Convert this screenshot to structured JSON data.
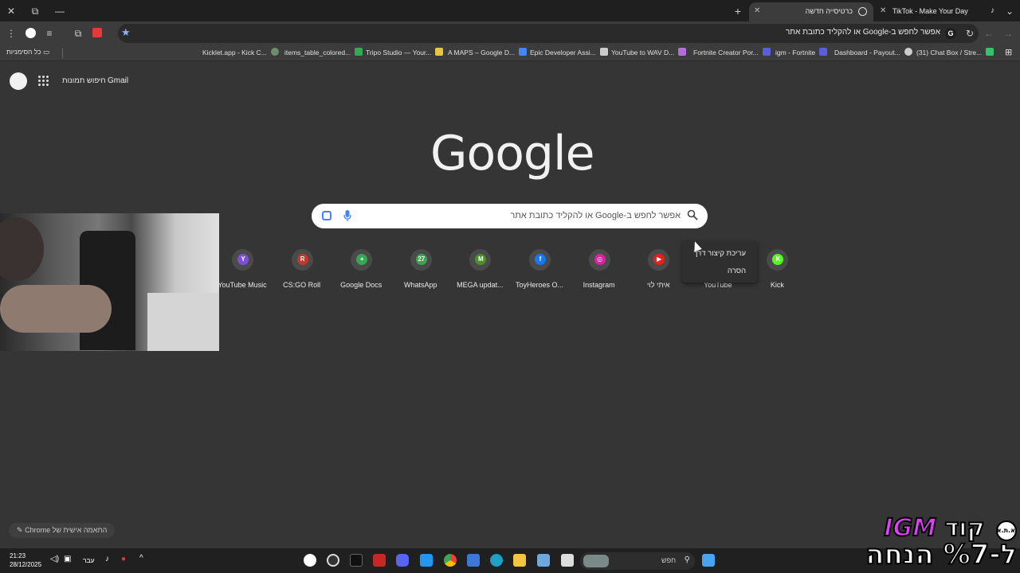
{
  "tabs": [
    {
      "title": "TikTok - Make Your Day",
      "active": false
    },
    {
      "title": "כרטיסייה חדשה",
      "active": true
    }
  ],
  "omnibox": {
    "text": "אפשר לחפש ב-Google או להקליד כתובת אתר",
    "badge": "G"
  },
  "bookmarks": {
    "all_label": "כל הסימניות",
    "items": [
      {
        "label": "Kicklet.app - Kick C...",
        "color": "#6b8f6b"
      },
      {
        "label": "items_table_colored...",
        "color": "#34a853"
      },
      {
        "label": "Tripo Studio — Your...",
        "color": "#e8c44a"
      },
      {
        "label": "A MAPS – Google D...",
        "color": "#4285f4"
      },
      {
        "label": "Epic Developer Assi...",
        "color": "#cccccc"
      },
      {
        "label": "YouTube to WAV D...",
        "color": "#b46cd9"
      },
      {
        "label": "Fortnite Creator Por...",
        "color": "#5a5fd6"
      },
      {
        "label": "igm - Fortnite",
        "color": "#5a5fd6"
      },
      {
        "label": "Dashboard - Payout...",
        "color": "#cccccc"
      },
      {
        "label": "(31) Chat Box / Stre...",
        "color": "#35c26b"
      }
    ]
  },
  "header_links": {
    "gmail": "Gmail",
    "images": "חיפוש תמונות"
  },
  "logo_text": "Google",
  "search": {
    "placeholder": "אפשר לחפש ב-Google או להקליד כתובת אתר"
  },
  "shortcuts": [
    {
      "label": "YouTube Music",
      "letter": "Y",
      "color": "#7b4fd6"
    },
    {
      "label": "CS:GO Roll",
      "letter": "R",
      "color": "#c0392b"
    },
    {
      "label": "Google Docs",
      "letter": "+",
      "color": "#34a853"
    },
    {
      "label": "WhatsApp",
      "letter": "27",
      "color": "#3fa34d"
    },
    {
      "label": "MEGA updat...",
      "letter": "M",
      "color": "#4a8f2a"
    },
    {
      "label": "ToyHeroes O...",
      "letter": "f",
      "color": "#1877f2"
    },
    {
      "label": "Instagram",
      "letter": "◎",
      "color": "#d6249f"
    },
    {
      "label": "איתי לוי",
      "letter": "▶",
      "color": "#e62117"
    },
    {
      "label": "YouTube",
      "letter": "",
      "color": "#4a4a4a"
    },
    {
      "label": "Kick",
      "letter": "K",
      "color": "#53fc18"
    }
  ],
  "context_menu": {
    "edit": "עריכת קיצור דרך",
    "remove": "הסרה"
  },
  "customize": "התאמה אישית של Chrome",
  "taskbar": {
    "time": "21:23",
    "date": "28/12/2025",
    "lang": "עבר",
    "search": "חפש"
  },
  "promo": {
    "badge": "א.ת.א",
    "line1_word": "קוד",
    "line1_brand": "IGM",
    "line2": "ל-%7 הנחה"
  },
  "colors": {
    "page_bg": "#353535",
    "toolbar_bg": "#3c3c3c",
    "tabstrip_bg": "#1f1f1f",
    "accent": "#8ab4f8"
  }
}
